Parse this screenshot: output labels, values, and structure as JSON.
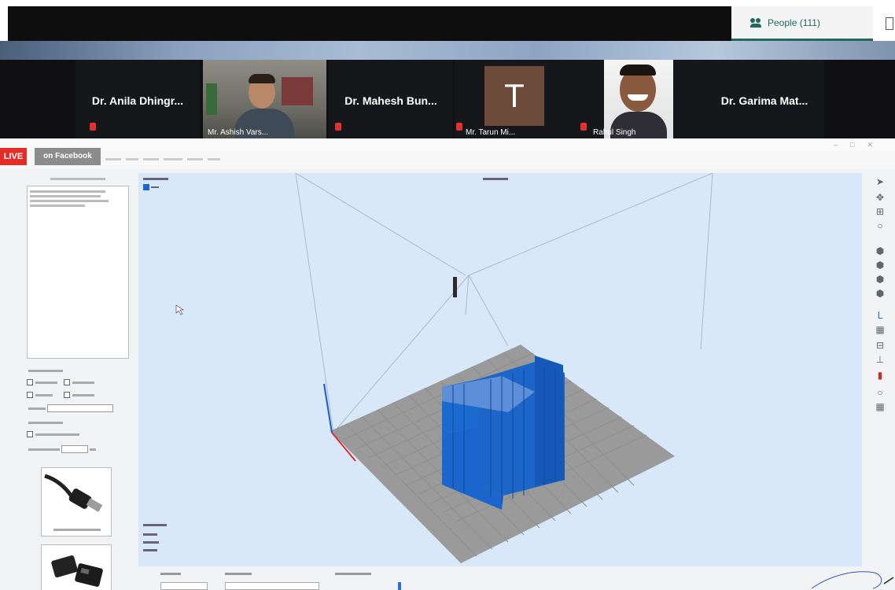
{
  "meeting": {
    "people_tab_label": "People (111)"
  },
  "participants": [
    {
      "name": "Dr. Anila Dhingr..."
    },
    {
      "name": "Mr. Ashish Vars..."
    },
    {
      "name": "Dr. Mahesh Bun..."
    },
    {
      "name": "Mr. Tarun Mi..."
    },
    {
      "name": "Rahul Singh"
    },
    {
      "name": "Dr. Garima Mat..."
    }
  ],
  "avatar_letter": "T",
  "stream": {
    "live_label": "LIVE",
    "platform_label": "on Facebook"
  },
  "colors": {
    "people_accent": "#1f6a5a",
    "live_red": "#e52d27",
    "model_blue": "#1a66cc",
    "bed_gray": "#9a9a9a",
    "viewport_bg": "#d8e8f8",
    "mic_muted": "#e0322f"
  },
  "icons": [
    "people-icon",
    "muted-mic-icon",
    "usb-cable-icon",
    "sd-card-icon"
  ]
}
